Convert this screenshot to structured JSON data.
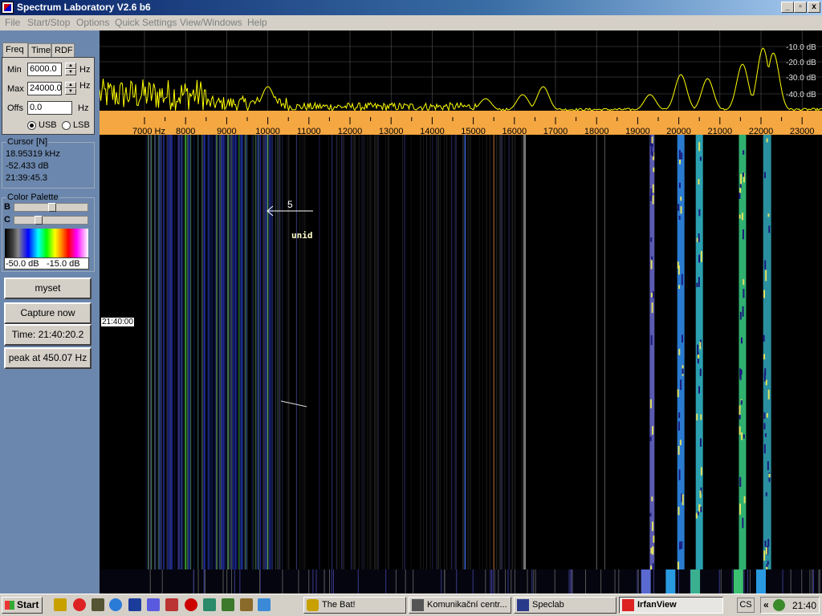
{
  "window": {
    "title": "Spectrum Laboratory V2.6 b6",
    "min_label": "_",
    "max_label": "▫",
    "close_label": "x"
  },
  "menu": [
    "File",
    "Start/Stop",
    "Options",
    "Quick Settings",
    "View/Windows",
    "Help"
  ],
  "tabs": [
    "Freq",
    "Time",
    "RDF"
  ],
  "freq": {
    "min_label": "Min",
    "min_value": "6000.0",
    "max_label": "Max",
    "max_value": "24000.0",
    "offs_label": "Offs",
    "offs_value": "0.0",
    "unit": "Hz",
    "usb": "USB",
    "lsb": "LSB"
  },
  "cursor": {
    "title": "Cursor [N]",
    "freq": "18.95319 kHz",
    "level": "-52.433 dB",
    "time": "21:39:45.3"
  },
  "palette": {
    "title": "Color Palette",
    "b": "B",
    "c": "C",
    "b_level": 0.5,
    "c_level": 0.3,
    "min": "-50.0 dB",
    "max": "-15.0 dB"
  },
  "buttons": {
    "myset": "myset",
    "capture": "Capture now",
    "time": "Time:  21:40:20.2",
    "peak": "peak at 450.07 Hz"
  },
  "spectrum": {
    "db_labels": [
      "-10.0 dB",
      "-20.0 dB",
      "-30.0 dB",
      "-40.0 dB"
    ],
    "freq_labels": [
      "7000 Hz",
      "8000",
      "9000",
      "10000",
      "11000",
      "12000",
      "13000",
      "14000",
      "15000",
      "16000",
      "17000",
      "18000",
      "19000",
      "20000",
      "21000",
      "22000",
      "23000"
    ]
  },
  "waterfall": {
    "time_label": "21:40:00",
    "annotation_num": "5",
    "annotation_text": "unid"
  },
  "colors": {
    "scale_bg": "#f5a742",
    "trace": "#ffff00",
    "panel_bg": "#6c87ad"
  },
  "taskbar": {
    "start": "Start",
    "tasks": [
      "The Bat!",
      "Komunikační centr...",
      "Speclab",
      "IrfanView"
    ],
    "lang": "CS",
    "clock": "21:40",
    "tray_arrows": "«"
  }
}
